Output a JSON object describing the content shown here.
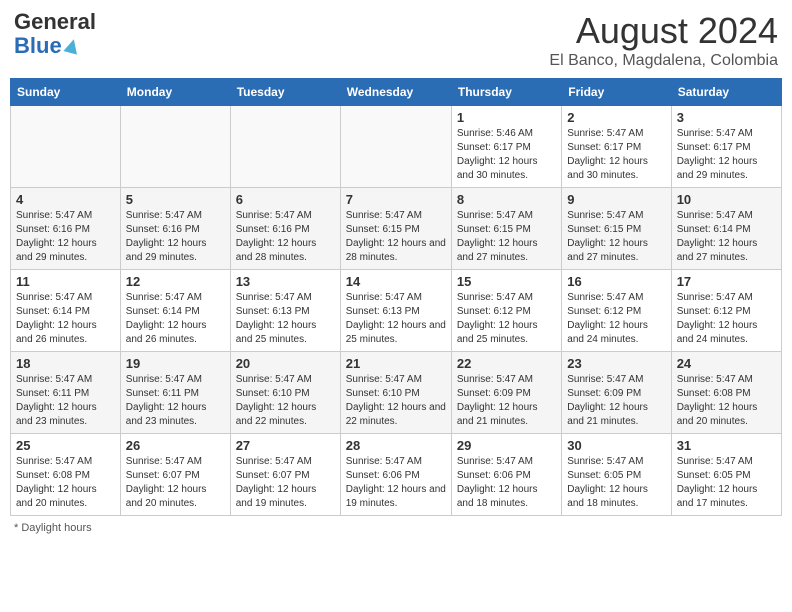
{
  "header": {
    "logo_general": "General",
    "logo_blue": "Blue",
    "month_year": "August 2024",
    "location": "El Banco, Magdalena, Colombia"
  },
  "days_of_week": [
    "Sunday",
    "Monday",
    "Tuesday",
    "Wednesday",
    "Thursday",
    "Friday",
    "Saturday"
  ],
  "weeks": [
    [
      {
        "day": "",
        "info": ""
      },
      {
        "day": "",
        "info": ""
      },
      {
        "day": "",
        "info": ""
      },
      {
        "day": "",
        "info": ""
      },
      {
        "day": "1",
        "info": "Sunrise: 5:46 AM\nSunset: 6:17 PM\nDaylight: 12 hours and 30 minutes."
      },
      {
        "day": "2",
        "info": "Sunrise: 5:47 AM\nSunset: 6:17 PM\nDaylight: 12 hours and 30 minutes."
      },
      {
        "day": "3",
        "info": "Sunrise: 5:47 AM\nSunset: 6:17 PM\nDaylight: 12 hours and 29 minutes."
      }
    ],
    [
      {
        "day": "4",
        "info": "Sunrise: 5:47 AM\nSunset: 6:16 PM\nDaylight: 12 hours and 29 minutes."
      },
      {
        "day": "5",
        "info": "Sunrise: 5:47 AM\nSunset: 6:16 PM\nDaylight: 12 hours and 29 minutes."
      },
      {
        "day": "6",
        "info": "Sunrise: 5:47 AM\nSunset: 6:16 PM\nDaylight: 12 hours and 28 minutes."
      },
      {
        "day": "7",
        "info": "Sunrise: 5:47 AM\nSunset: 6:15 PM\nDaylight: 12 hours and 28 minutes."
      },
      {
        "day": "8",
        "info": "Sunrise: 5:47 AM\nSunset: 6:15 PM\nDaylight: 12 hours and 27 minutes."
      },
      {
        "day": "9",
        "info": "Sunrise: 5:47 AM\nSunset: 6:15 PM\nDaylight: 12 hours and 27 minutes."
      },
      {
        "day": "10",
        "info": "Sunrise: 5:47 AM\nSunset: 6:14 PM\nDaylight: 12 hours and 27 minutes."
      }
    ],
    [
      {
        "day": "11",
        "info": "Sunrise: 5:47 AM\nSunset: 6:14 PM\nDaylight: 12 hours and 26 minutes."
      },
      {
        "day": "12",
        "info": "Sunrise: 5:47 AM\nSunset: 6:14 PM\nDaylight: 12 hours and 26 minutes."
      },
      {
        "day": "13",
        "info": "Sunrise: 5:47 AM\nSunset: 6:13 PM\nDaylight: 12 hours and 25 minutes."
      },
      {
        "day": "14",
        "info": "Sunrise: 5:47 AM\nSunset: 6:13 PM\nDaylight: 12 hours and 25 minutes."
      },
      {
        "day": "15",
        "info": "Sunrise: 5:47 AM\nSunset: 6:12 PM\nDaylight: 12 hours and 25 minutes."
      },
      {
        "day": "16",
        "info": "Sunrise: 5:47 AM\nSunset: 6:12 PM\nDaylight: 12 hours and 24 minutes."
      },
      {
        "day": "17",
        "info": "Sunrise: 5:47 AM\nSunset: 6:12 PM\nDaylight: 12 hours and 24 minutes."
      }
    ],
    [
      {
        "day": "18",
        "info": "Sunrise: 5:47 AM\nSunset: 6:11 PM\nDaylight: 12 hours and 23 minutes."
      },
      {
        "day": "19",
        "info": "Sunrise: 5:47 AM\nSunset: 6:11 PM\nDaylight: 12 hours and 23 minutes."
      },
      {
        "day": "20",
        "info": "Sunrise: 5:47 AM\nSunset: 6:10 PM\nDaylight: 12 hours and 22 minutes."
      },
      {
        "day": "21",
        "info": "Sunrise: 5:47 AM\nSunset: 6:10 PM\nDaylight: 12 hours and 22 minutes."
      },
      {
        "day": "22",
        "info": "Sunrise: 5:47 AM\nSunset: 6:09 PM\nDaylight: 12 hours and 21 minutes."
      },
      {
        "day": "23",
        "info": "Sunrise: 5:47 AM\nSunset: 6:09 PM\nDaylight: 12 hours and 21 minutes."
      },
      {
        "day": "24",
        "info": "Sunrise: 5:47 AM\nSunset: 6:08 PM\nDaylight: 12 hours and 20 minutes."
      }
    ],
    [
      {
        "day": "25",
        "info": "Sunrise: 5:47 AM\nSunset: 6:08 PM\nDaylight: 12 hours and 20 minutes."
      },
      {
        "day": "26",
        "info": "Sunrise: 5:47 AM\nSunset: 6:07 PM\nDaylight: 12 hours and 20 minutes."
      },
      {
        "day": "27",
        "info": "Sunrise: 5:47 AM\nSunset: 6:07 PM\nDaylight: 12 hours and 19 minutes."
      },
      {
        "day": "28",
        "info": "Sunrise: 5:47 AM\nSunset: 6:06 PM\nDaylight: 12 hours and 19 minutes."
      },
      {
        "day": "29",
        "info": "Sunrise: 5:47 AM\nSunset: 6:06 PM\nDaylight: 12 hours and 18 minutes."
      },
      {
        "day": "30",
        "info": "Sunrise: 5:47 AM\nSunset: 6:05 PM\nDaylight: 12 hours and 18 minutes."
      },
      {
        "day": "31",
        "info": "Sunrise: 5:47 AM\nSunset: 6:05 PM\nDaylight: 12 hours and 17 minutes."
      }
    ]
  ],
  "footer": {
    "note": "Daylight hours"
  }
}
